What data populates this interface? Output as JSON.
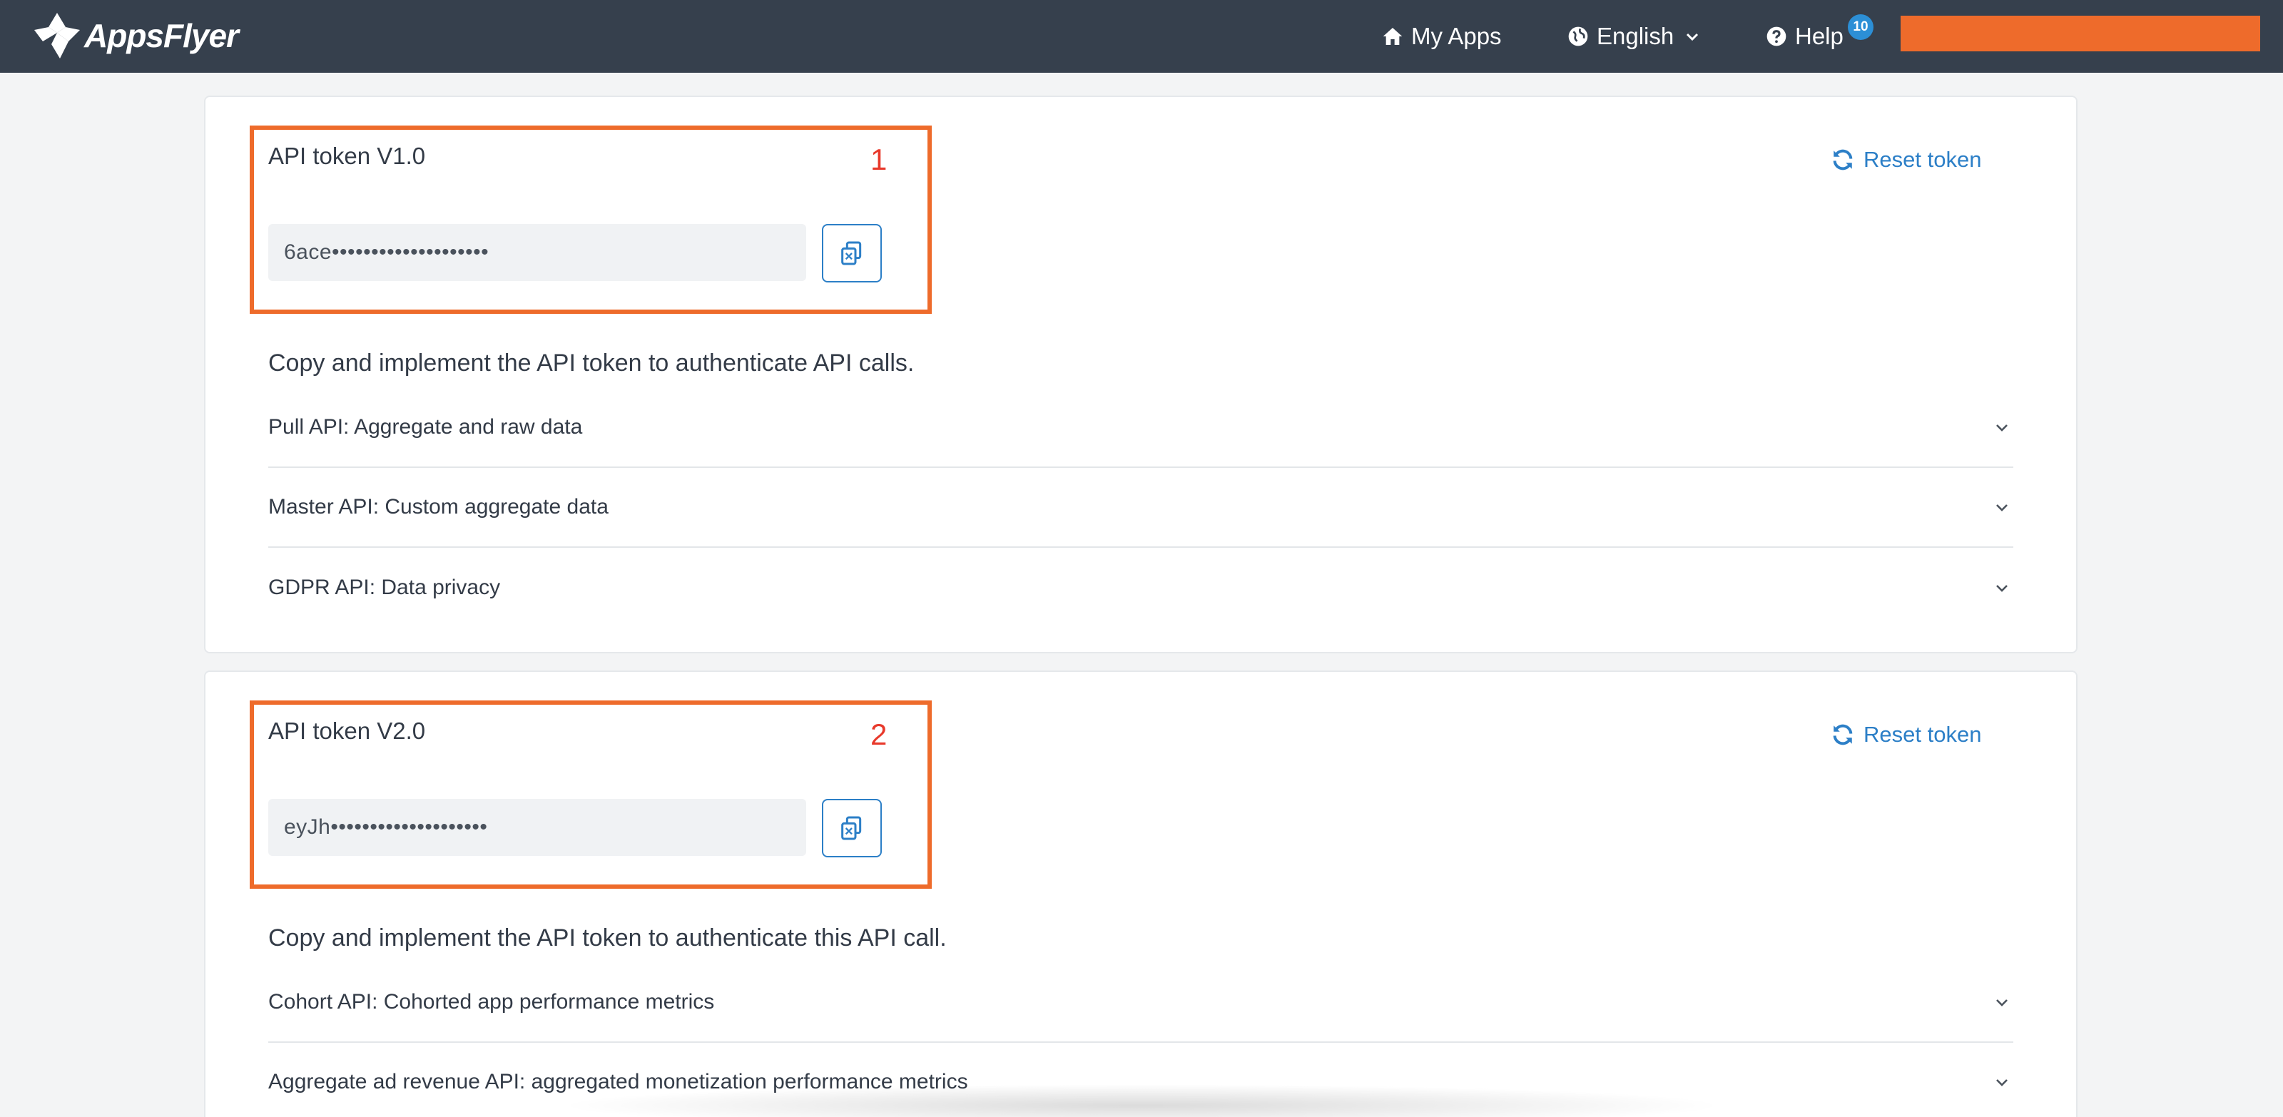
{
  "header": {
    "logo_text": "AppsFlyer",
    "my_apps": "My Apps",
    "language": "English",
    "help": "Help",
    "help_badge": "10",
    "account_bar_color": "#ee6b2b"
  },
  "tokens": [
    {
      "marker": "1",
      "title": "API token V1.0",
      "value": "6ace••••••••••••••••••••",
      "reset_label": "Reset token",
      "description": "Copy and implement the API token to authenticate API calls.",
      "apis": [
        "Pull API: Aggregate and raw data",
        "Master API: Custom aggregate data",
        "GDPR API: Data privacy"
      ]
    },
    {
      "marker": "2",
      "title": "API token V2.0",
      "value": "eyJh••••••••••••••••••••",
      "reset_label": "Reset token",
      "description": "Copy and implement the API token to authenticate this API call.",
      "apis": [
        "Cohort API: Cohorted app performance metrics",
        "Aggregate ad revenue API: aggregated monetization performance metrics"
      ]
    }
  ],
  "colors": {
    "topbar": "#36404d",
    "accent_blue": "#2c7fc7",
    "highlight_orange": "#ee6b2b",
    "marker_red": "#e8392b"
  },
  "icons": [
    "appsflyer-logo-icon",
    "home-icon",
    "globe-icon",
    "chevron-down-icon",
    "help-circle-icon",
    "refresh-icon",
    "copy-icon"
  ]
}
